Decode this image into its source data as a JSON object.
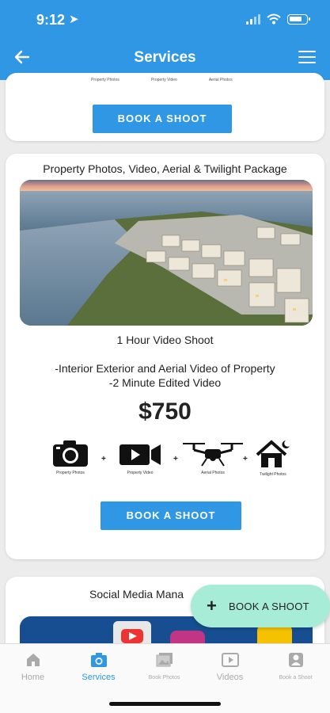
{
  "status_bar": {
    "time": "9:12",
    "location_icon": "location-arrow-icon",
    "icons": [
      "signal-icon",
      "wifi-icon",
      "battery-icon"
    ]
  },
  "header": {
    "title": "Services",
    "back_icon": "back-arrow-icon",
    "menu_icon": "hamburger-icon",
    "color": "#2f97e4"
  },
  "card_top": {
    "feature_labels": [
      "Property Photos",
      "Property Video",
      "Aerial Photos"
    ],
    "button_label": "BOOK A SHOOT"
  },
  "package": {
    "title": "Property Photos, Video, Aerial & Twilight Package",
    "subtitle": "1 Hour Video Shoot",
    "description": [
      "-Interior Exterior and Aerial Video of Property",
      "-2 Minute Edited Video"
    ],
    "price": "$750",
    "features": [
      {
        "icon": "camera-icon",
        "label": "Property Photos"
      },
      {
        "icon": "video-camera-icon",
        "label": "Property Video"
      },
      {
        "icon": "drone-icon",
        "label": "Aerial Photos"
      },
      {
        "icon": "house-moon-icon",
        "label": "Twilight Photos"
      }
    ],
    "separator": "+",
    "button_label": "BOOK A SHOOT"
  },
  "card_social": {
    "title": "Social Media Mana"
  },
  "fab": {
    "label": "BOOK A SHOOT",
    "icon": "plus-icon",
    "color": "#a7ecd6"
  },
  "tabs": [
    {
      "label": "Home",
      "icon": "home-icon",
      "active": false
    },
    {
      "label": "Services",
      "icon": "camera-icon",
      "active": true
    },
    {
      "label": "Book Photos",
      "icon": "photos-icon",
      "active": false
    },
    {
      "label": "Videos",
      "icon": "play-icon",
      "active": false
    },
    {
      "label": "Book a Shoot",
      "icon": "person-icon",
      "active": false
    }
  ]
}
